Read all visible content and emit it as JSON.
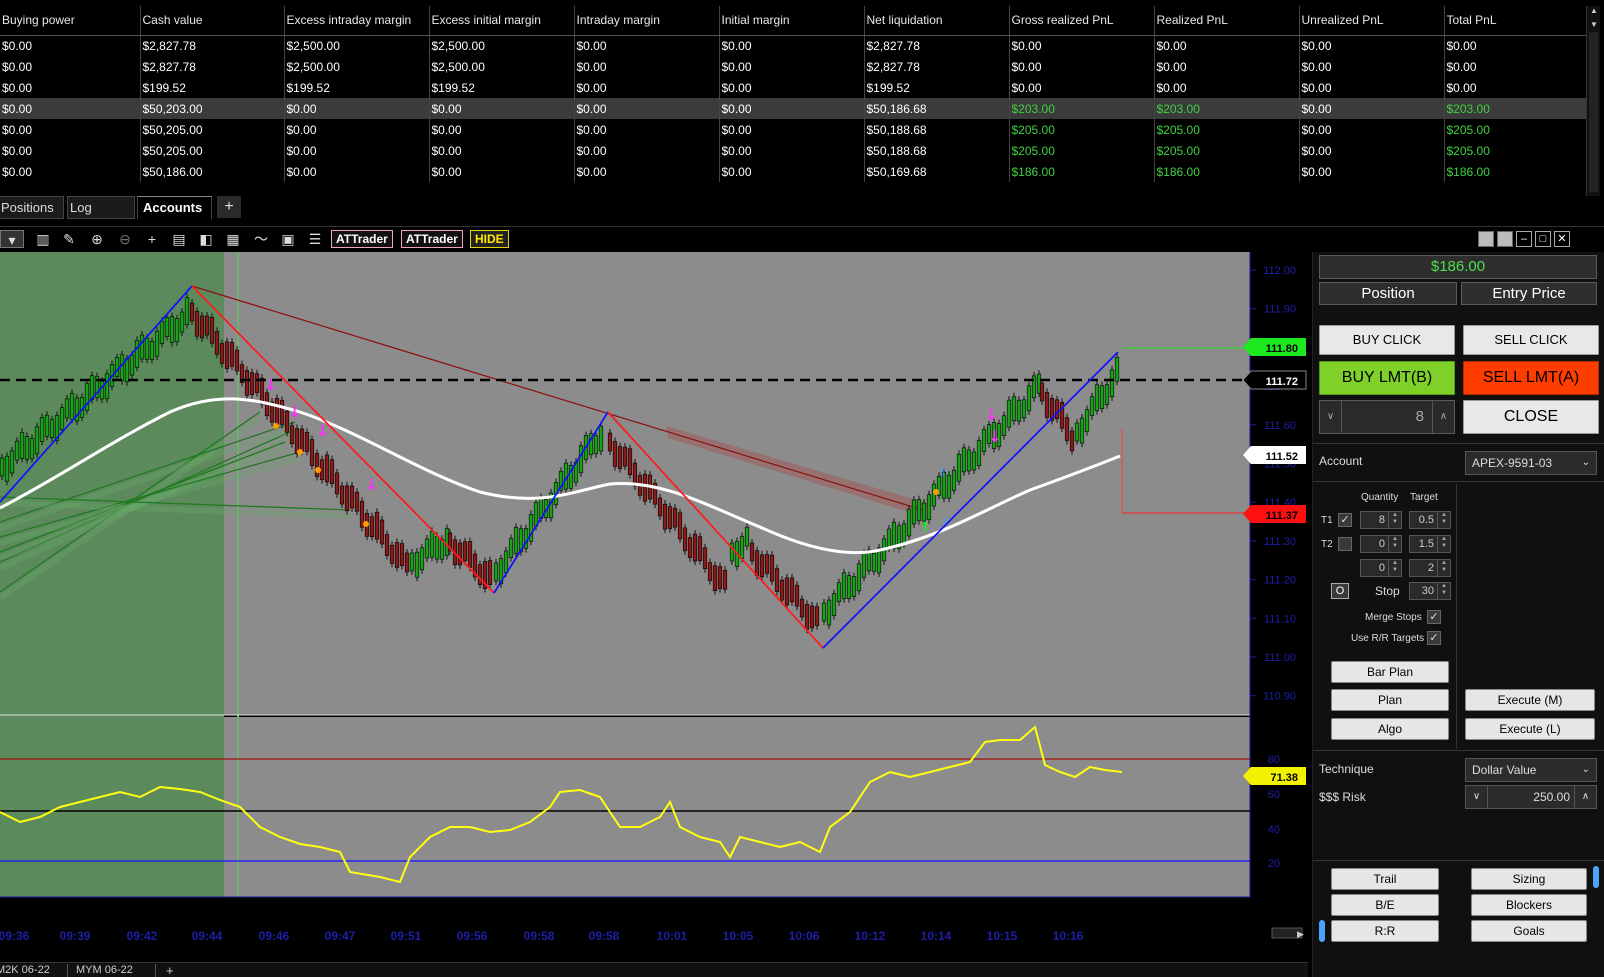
{
  "accounts": {
    "columns": [
      "Buying power",
      "Cash value",
      "Excess intraday margin",
      "Excess initial margin",
      "Intraday margin",
      "Initial margin",
      "Net liquidation",
      "Gross realized PnL",
      "Realized PnL",
      "Unrealized PnL",
      "Total PnL"
    ],
    "rows": [
      [
        "$0.00",
        "$2,827.78",
        "$2,500.00",
        "$2,500.00",
        "$0.00",
        "$0.00",
        "$2,827.78",
        "$0.00",
        "$0.00",
        "$0.00",
        "$0.00"
      ],
      [
        "$0.00",
        "$2,827.78",
        "$2,500.00",
        "$2,500.00",
        "$0.00",
        "$0.00",
        "$2,827.78",
        "$0.00",
        "$0.00",
        "$0.00",
        "$0.00"
      ],
      [
        "$0.00",
        "$199.52",
        "$199.52",
        "$199.52",
        "$0.00",
        "$0.00",
        "$199.52",
        "$0.00",
        "$0.00",
        "$0.00",
        "$0.00"
      ],
      [
        "$0.00",
        "$50,203.00",
        "$0.00",
        "$0.00",
        "$0.00",
        "$0.00",
        "$50,186.68",
        "$203.00",
        "$203.00",
        "$0.00",
        "$203.00"
      ],
      [
        "$0.00",
        "$50,205.00",
        "$0.00",
        "$0.00",
        "$0.00",
        "$0.00",
        "$50,188.68",
        "$205.00",
        "$205.00",
        "$0.00",
        "$205.00"
      ],
      [
        "$0.00",
        "$50,205.00",
        "$0.00",
        "$0.00",
        "$0.00",
        "$0.00",
        "$50,188.68",
        "$205.00",
        "$205.00",
        "$0.00",
        "$205.00"
      ],
      [
        "$0.00",
        "$50,186.00",
        "$0.00",
        "$0.00",
        "$0.00",
        "$0.00",
        "$50,169.68",
        "$186.00",
        "$186.00",
        "$0.00",
        "$186.00"
      ]
    ],
    "selected_row": 3
  },
  "tabs": {
    "positions": "Positions",
    "log": "Log",
    "accounts": "Accounts",
    "plus": "+"
  },
  "toolbar": {
    "attrader1": "ATTrader",
    "attrader2": "ATTrader",
    "hide": "HIDE"
  },
  "chart": {
    "price_axis": [
      "112.00",
      "111.90",
      "111.80",
      "111.70",
      "111.60",
      "111.50",
      "111.40",
      "111.30",
      "111.20",
      "111.10",
      "111.00",
      "110.90"
    ],
    "osc_axis": [
      "80",
      "60",
      "40",
      "20"
    ],
    "time_axis": [
      "09:36",
      "09:39",
      "09:42",
      "09:44",
      "09:46",
      "09:47",
      "09:51",
      "09:56",
      "09:58",
      "09:58",
      "10:01",
      "10:05",
      "10:06",
      "10:12",
      "10:14",
      "10:15",
      "10:16"
    ],
    "labels": {
      "green": "111.80",
      "black": "111.72",
      "white": "111.52",
      "red": "111.37",
      "osc": "71.38"
    },
    "instrument_tabs": [
      "M2K 06-22",
      "MYM 06-22",
      "+"
    ],
    "colors": {
      "green_label": "#1ee81e",
      "red_label": "#ff1010",
      "osc_label": "#f2f200",
      "bull": "#16a316",
      "bear": "#8b1a1a"
    }
  },
  "panel": {
    "pnl": "$186.00",
    "position": "Position",
    "entry_price": "Entry Price",
    "buy_click": "BUY CLICK",
    "sell_click": "SELL CLICK",
    "buy_lmt": "BUY LMT(B)",
    "sell_lmt": "SELL LMT(A)",
    "qty": "8",
    "close": "CLOSE",
    "account_label": "Account",
    "account_value": "APEX-9591-03",
    "quantity_hdr": "Quantity",
    "target_hdr": "Target",
    "t1": "T1",
    "t2": "T2",
    "t1_qty": "8",
    "t1_target": "0.5",
    "t2_qty": "0",
    "t2_target": "1.5",
    "t3_qty": "0",
    "t3_target": "2",
    "o_label": "O",
    "stop_label": "Stop",
    "stop_value": "30",
    "merge_stops": "Merge Stops",
    "use_rr": "Use R/R Targets",
    "bar_plan": "Bar Plan",
    "plan": "Plan",
    "algo": "Algo",
    "execute_m": "Execute (M)",
    "execute_l": "Execute (L)",
    "technique_label": "Technique",
    "technique_value": "Dollar Value",
    "risk_label": "$$$ Risk",
    "risk_value": "250.00",
    "trail": "Trail",
    "sizing": "Sizing",
    "be": "B/E",
    "blockers": "Blockers",
    "rr": "R:R",
    "goals": "Goals",
    "colors": {
      "buy": "#7fd12a",
      "sell": "#ff3d00",
      "pnl": "#4ce04c"
    }
  }
}
